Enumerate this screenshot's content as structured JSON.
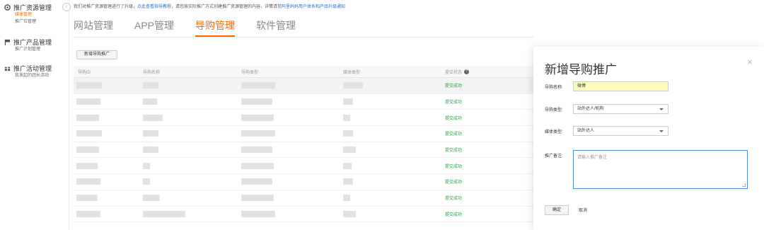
{
  "sidebar": {
    "groups": [
      {
        "title": "推广资源管理",
        "icon": "settings-icon",
        "items": [
          "媒体管理",
          "推广位管理"
        ],
        "active_index": 0
      },
      {
        "title": "推广产品管理",
        "icon": "flag-icon",
        "items": [
          "推广计划管理"
        ]
      },
      {
        "title": "推广活动管理",
        "icon": "gift-icon",
        "items": [
          "我发起的团长活动"
        ]
      }
    ],
    "collapse_label": "‹"
  },
  "notice": {
    "text": "我们对推广资源管理进行了升级，",
    "link1": "点此查看指导教程",
    "text2": "，请您按实际推广方式创建推广资源管理的内容，详情请见",
    "link2": "阿里妈妈用户体系和产品升级通知"
  },
  "tabs": [
    "网站管理",
    "APP管理",
    "导购管理",
    "软件管理"
  ],
  "active_tab": 2,
  "add_button": "新增导购推广",
  "table": {
    "headers": [
      "导购ID",
      "导购名称",
      "导购类型",
      "媒体类型",
      "提交状态"
    ],
    "status_values": [
      "提交成功",
      "提交成功",
      "提交成功",
      "提交成功",
      "提交成功",
      "提交成功",
      "提交成功",
      "提交成功",
      "提交成功"
    ]
  },
  "modal": {
    "title": "新增导购推广",
    "close": "×",
    "name_label": "导购名称:",
    "name_value": "微博",
    "type_label": "导购类型:",
    "type_value": "站外达人/机构",
    "media_label": "媒体类型:",
    "media_value": "站外达人",
    "remark_label": "推广备注:",
    "remark_placeholder": "请输入推广备注",
    "ok": "确定",
    "cancel": "取消"
  }
}
